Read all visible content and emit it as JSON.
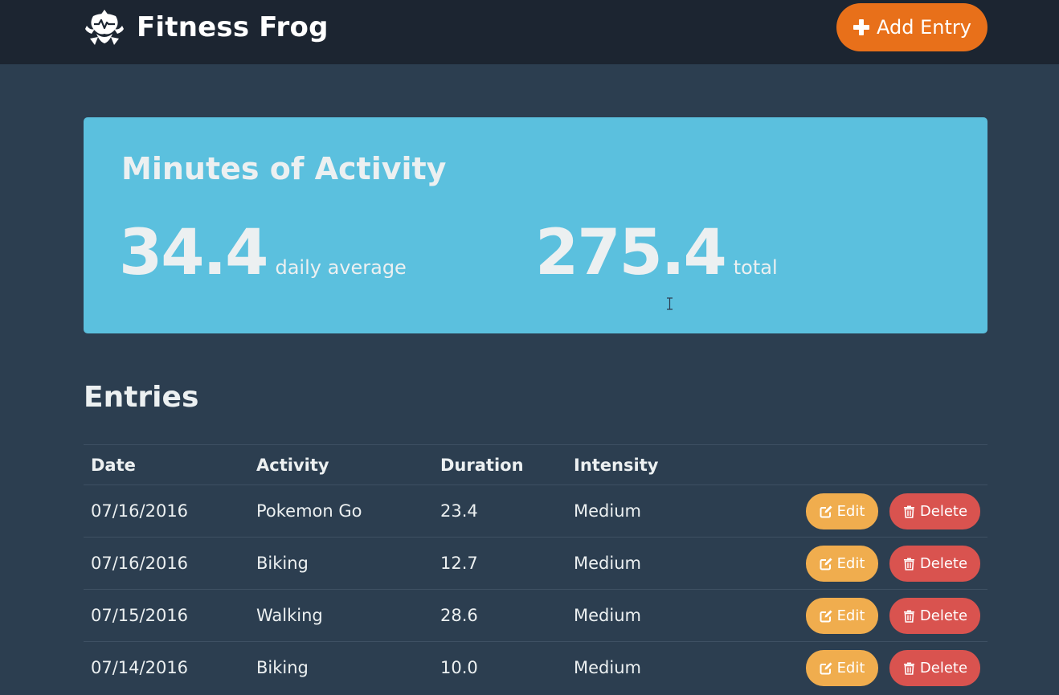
{
  "header": {
    "brand_name": "Fitness Frog",
    "logo_icon": "frog-logo-icon",
    "add_entry_label": "Add Entry",
    "add_entry_icon": "plus-icon"
  },
  "stats": {
    "title": "Minutes of Activity",
    "daily_average_value": "34.4",
    "daily_average_label": "daily average",
    "total_value": "275.4",
    "total_label": "total"
  },
  "entries": {
    "title": "Entries",
    "columns": [
      "Date",
      "Activity",
      "Duration",
      "Intensity"
    ],
    "rows": [
      {
        "date": "07/16/2016",
        "activity": "Pokemon Go",
        "duration": "23.4",
        "intensity": "Medium",
        "edit_label": "Edit",
        "delete_label": "Delete"
      },
      {
        "date": "07/16/2016",
        "activity": "Biking",
        "duration": "12.7",
        "intensity": "Medium",
        "edit_label": "Edit",
        "delete_label": "Delete"
      },
      {
        "date": "07/15/2016",
        "activity": "Walking",
        "duration": "28.6",
        "intensity": "Medium",
        "edit_label": "Edit",
        "delete_label": "Delete"
      },
      {
        "date": "07/14/2016",
        "activity": "Biking",
        "duration": "10.0",
        "intensity": "Medium",
        "edit_label": "Edit",
        "delete_label": "Delete"
      }
    ]
  },
  "colors": {
    "background": "#2c3e50",
    "topbar": "#1c2531",
    "accent_orange": "#e8701a",
    "panel_blue": "#5bc0de",
    "edit_yellow": "#f0ad4e",
    "delete_red": "#d9534f"
  }
}
